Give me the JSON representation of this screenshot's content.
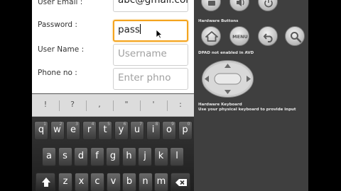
{
  "form": {
    "email_label": "User Email :",
    "email_value": "abc@gmail.com",
    "password_label": "Password :",
    "password_value": "pass",
    "username_label": "User Name :",
    "username_placeholder": "Username",
    "phone_label": "Phone no :",
    "phone_placeholder": "Enter phno"
  },
  "keyboard": {
    "symbols": [
      "!",
      "?",
      ",",
      "\"",
      "'",
      ":"
    ],
    "row1": [
      {
        "k": "q",
        "n": "1"
      },
      {
        "k": "w",
        "n": "2"
      },
      {
        "k": "e",
        "n": "3"
      },
      {
        "k": "r",
        "n": "4"
      },
      {
        "k": "t",
        "n": "5"
      },
      {
        "k": "y",
        "n": "6"
      },
      {
        "k": "u",
        "n": "7"
      },
      {
        "k": "i",
        "n": "8"
      },
      {
        "k": "o",
        "n": "9"
      },
      {
        "k": "p",
        "n": "0"
      }
    ],
    "row2": [
      "a",
      "s",
      "d",
      "f",
      "g",
      "h",
      "j",
      "k",
      "l"
    ],
    "row3": [
      "z",
      "x",
      "c",
      "v",
      "b",
      "n",
      "m"
    ]
  },
  "panel": {
    "hardware_buttons_label": "Hardware Buttons",
    "menu_label": "MENU",
    "dpad_label": "DPAD not enabled in AVD",
    "hw_keyboard_title": "Hardware Keyboard",
    "hw_keyboard_note": "Use your physical keyboard to provide input"
  },
  "colors": {
    "focus_border": "#f4a41f",
    "panel_bg": "#3f3f3f"
  }
}
